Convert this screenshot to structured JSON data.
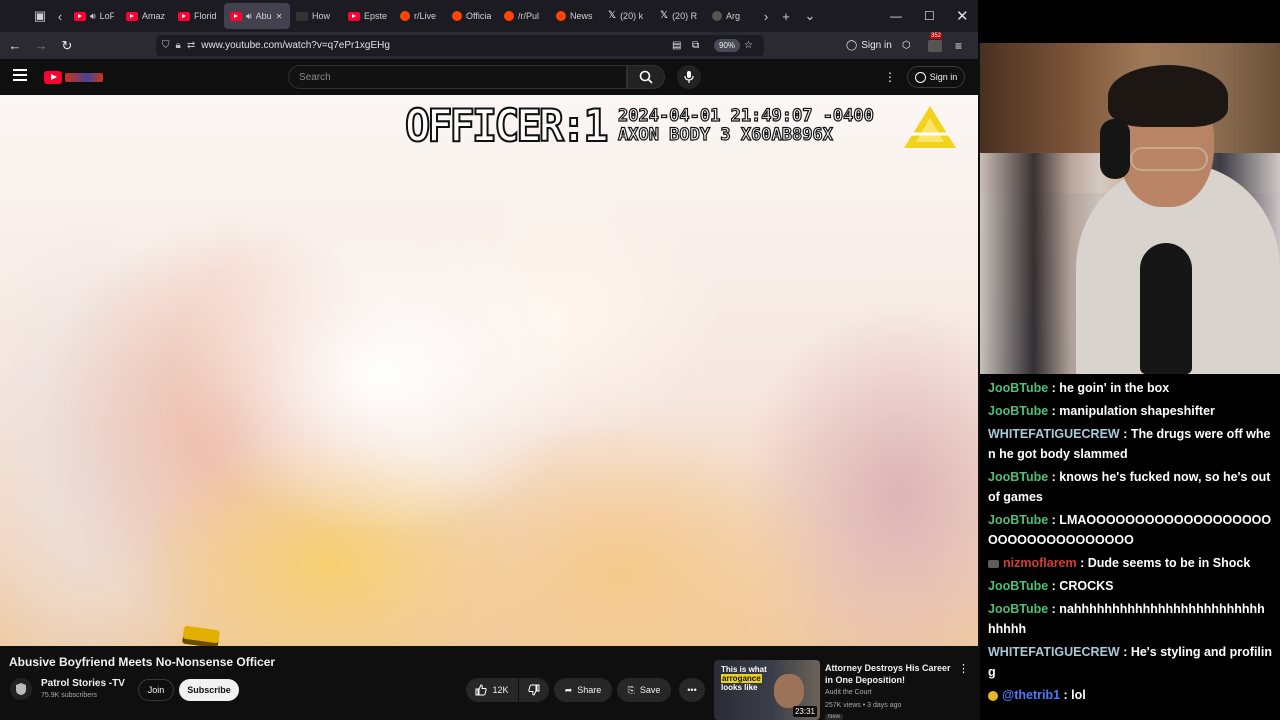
{
  "browser": {
    "tabs": [
      {
        "label": "LoFi In",
        "icon": "youtube",
        "audio": true,
        "active": false
      },
      {
        "label": "Amaz",
        "icon": "youtube",
        "audio": false,
        "active": false
      },
      {
        "label": "Florid",
        "icon": "youtube",
        "audio": false,
        "active": false
      },
      {
        "label": "Abu",
        "icon": "youtube",
        "audio": true,
        "active": true
      },
      {
        "label": "How",
        "icon": "dark",
        "audio": false,
        "active": false
      },
      {
        "label": "Epste",
        "icon": "youtube",
        "audio": false,
        "active": false
      },
      {
        "label": "r/Live",
        "icon": "reddit",
        "audio": false,
        "active": false
      },
      {
        "label": "Officia",
        "icon": "reddit",
        "audio": false,
        "active": false
      },
      {
        "label": "/r/Pul",
        "icon": "reddit",
        "audio": false,
        "active": false
      },
      {
        "label": "News",
        "icon": "reddit",
        "audio": false,
        "active": false
      },
      {
        "label": "(20) k",
        "icon": "x",
        "audio": false,
        "active": false
      },
      {
        "label": "(20) R",
        "icon": "x",
        "audio": false,
        "active": false
      },
      {
        "label": "Arg",
        "icon": "blank",
        "audio": false,
        "active": false
      }
    ],
    "url": "www.youtube.com/watch?v=q7ePr1xgEHg",
    "zoom": "90%",
    "signin_label": "Sign in",
    "extension_badge": "352"
  },
  "youtube": {
    "search_placeholder": "Search",
    "signin_label": "Sign in",
    "video": {
      "overlay_officer": "OFFICER:1",
      "overlay_timestamp": "2024-04-01 21:49:07 -0400",
      "overlay_device": "AXON BODY 3 X60AB896X"
    },
    "title": "Abusive Boyfriend Meets No-Nonsense Officer",
    "channel": {
      "name": "Patrol Stories -TV",
      "subscribers": "75.9K subscribers"
    },
    "join_label": "Join",
    "subscribe_label": "Subscribe",
    "like_count": "12K",
    "share_label": "Share",
    "save_label": "Save",
    "recommended": {
      "thumb_text_line1": "This is what",
      "thumb_text_highlight": "arrogance",
      "thumb_text_line3": "looks like",
      "duration": "23:31",
      "title": "Attorney Destroys His Career in One Deposition!",
      "channel": "Audit the Court",
      "meta": "257K views • 3 days ago",
      "badge": "New"
    }
  },
  "chat": {
    "messages": [
      {
        "user": "JooBTube",
        "text": ": he goin' in the box",
        "color": "#4fbf76",
        "badge": ""
      },
      {
        "user": "JooBTube",
        "text": ": manipulation shapeshifter",
        "color": "#4fbf76",
        "badge": ""
      },
      {
        "user": "WHITEFATIGUECREW",
        "text": ": The drugs were off when he got body slammed",
        "color": "#a9c9d9",
        "badge": ""
      },
      {
        "user": "JooBTube",
        "text": ": knows he's fucked now, so he's out of games",
        "color": "#4fbf76",
        "badge": ""
      },
      {
        "user": "JooBTube",
        "text": ": LMAOOOOOOOOOOOOOOOOOOOOOOOOOOOOOOOOOO",
        "color": "#4fbf76",
        "badge": ""
      },
      {
        "user": "nizmoflarem",
        "text": ": Dude seems to be in Shock",
        "color": "#d13e32",
        "badge": "gray"
      },
      {
        "user": "JooBTube",
        "text": ": CROCKS",
        "color": "#4fbf76",
        "badge": ""
      },
      {
        "user": "JooBTube",
        "text": ": nahhhhhhhhhhhhhhhhhhhhhhhhhhhhhh",
        "color": "#4fbf76",
        "badge": ""
      },
      {
        "user": "WHITEFATIGUECREW",
        "text": ": He's styling and profiling",
        "color": "#a9c9d9",
        "badge": ""
      },
      {
        "user": "@thetrib1",
        "text": ": lol",
        "color": "#4c79f5",
        "badge": "gold"
      }
    ]
  }
}
